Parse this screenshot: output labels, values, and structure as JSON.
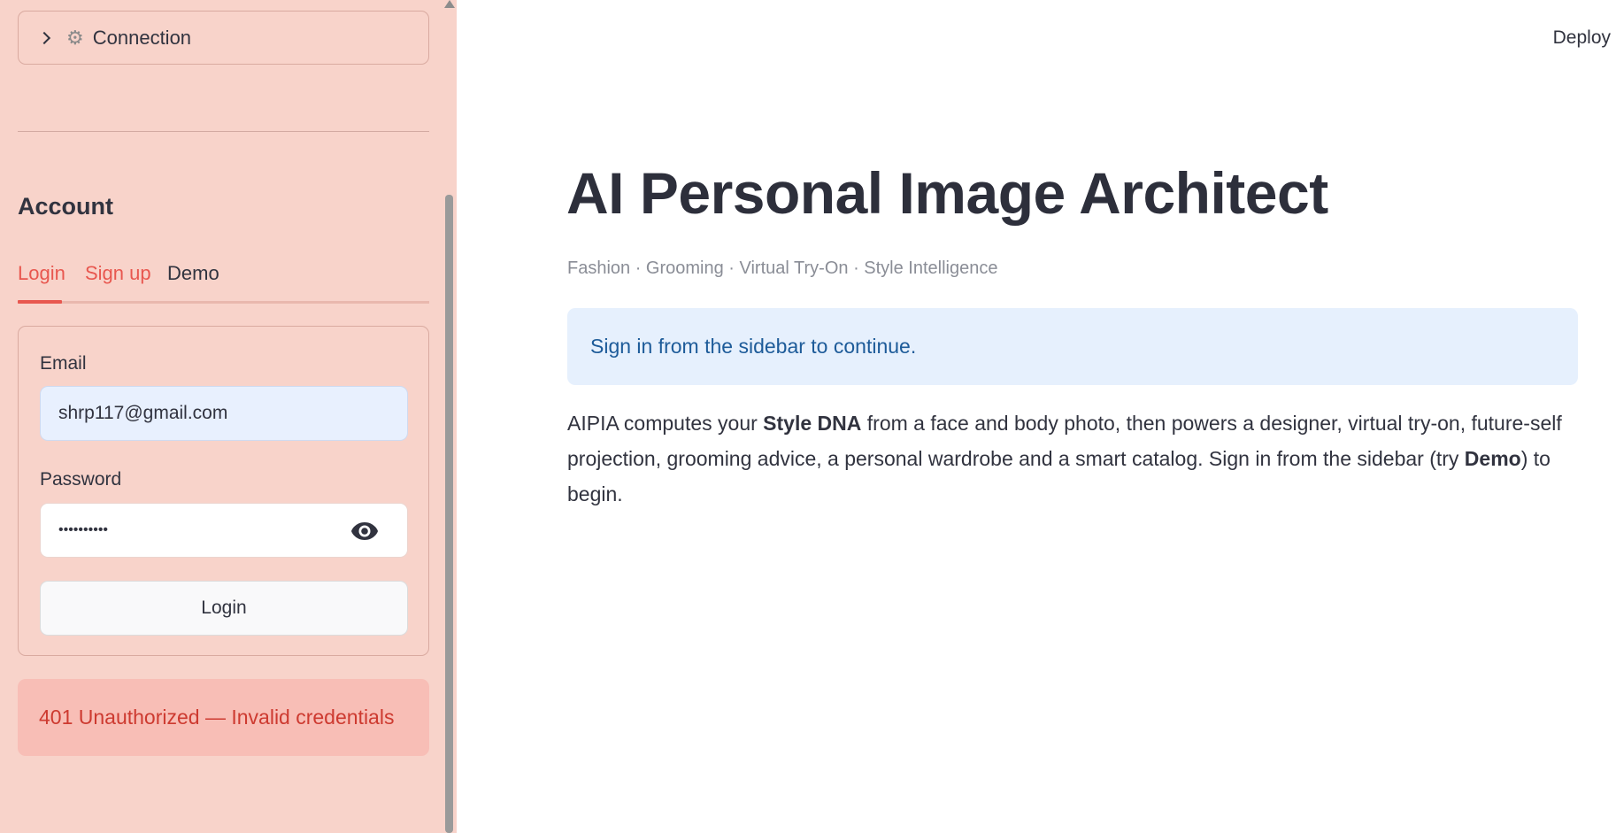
{
  "sidebar": {
    "expander": {
      "label": "Connection",
      "icon": "gear-icon"
    },
    "account": {
      "heading": "Account",
      "tabs": [
        {
          "label": "Login",
          "active": true
        },
        {
          "label": "Sign up",
          "active": false
        },
        {
          "label": "Demo",
          "active": false
        }
      ],
      "form": {
        "email_label": "Email",
        "email_value": "shrp117@gmail.com",
        "password_label": "Password",
        "password_value": "••••••••••",
        "login_button": "Login"
      },
      "error": "401 Unauthorized — Invalid credentials"
    }
  },
  "header": {
    "deploy_label": "Deploy"
  },
  "main": {
    "title": "AI Personal Image Architect",
    "subtitle": "Fashion · Grooming · Virtual Try-On · Style Intelligence",
    "info": "Sign in from the sidebar to continue.",
    "paragraph": {
      "part1": "AIPIA computes your ",
      "bold1": "Style DNA",
      "part2": " from a face and body photo, then powers a designer, virtual try-on, future-self projection, grooming advice, a personal wardrobe and a smart catalog. Sign in from the sidebar (try ",
      "bold2": "Demo",
      "part3": ") to begin."
    }
  },
  "colors": {
    "sidebar_bg": "#f8d3ca",
    "accent": "#e8574f",
    "info_bg": "#e6f0fd",
    "info_text": "#1d5b99",
    "error_bg": "#f8beb6",
    "error_text": "#cd3a30"
  }
}
